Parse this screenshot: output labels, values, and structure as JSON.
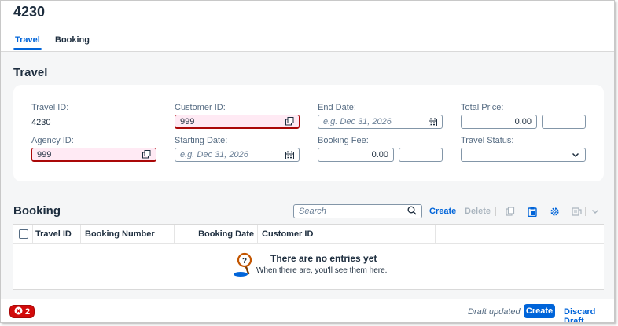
{
  "header": {
    "object_id": "4230",
    "tabs": [
      {
        "label": "Travel",
        "active": true
      },
      {
        "label": "Booking",
        "active": false
      }
    ]
  },
  "travel": {
    "title": "Travel",
    "travel_id": {
      "label": "Travel ID:",
      "value": "4230"
    },
    "agency_id": {
      "label": "Agency ID:",
      "value": "999"
    },
    "customer_id": {
      "label": "Customer ID:",
      "value": "999"
    },
    "starting_date": {
      "label": "Starting Date:",
      "placeholder": "e.g. Dec 31, 2026"
    },
    "end_date": {
      "label": "End Date:",
      "placeholder": "e.g. Dec 31, 2026"
    },
    "booking_fee": {
      "label": "Booking Fee:",
      "value": "0.00"
    },
    "total_price": {
      "label": "Total Price:",
      "value": "0.00"
    },
    "travel_status": {
      "label": "Travel Status:",
      "value": ""
    }
  },
  "booking": {
    "title": "Booking",
    "search_placeholder": "Search",
    "create_label": "Create",
    "delete_label": "Delete",
    "columns": [
      "Travel ID",
      "Booking Number",
      "Booking Date",
      "Customer ID"
    ],
    "empty_title": "There are no entries yet",
    "empty_subtitle": "When there are, you'll see them here."
  },
  "footer": {
    "error_count": "2",
    "draft_status": "Draft updated",
    "create_label": "Create",
    "discard_label": "Discard Draft"
  },
  "colors": {
    "accent": "#0064d9",
    "error": "#aa0808",
    "error_fill": "#ffeaf4"
  }
}
